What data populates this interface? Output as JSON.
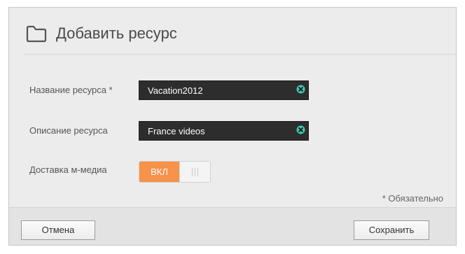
{
  "dialog": {
    "title": "Добавить ресурс",
    "title_icon": "folder-icon"
  },
  "form": {
    "share_name": {
      "label": "Название ресурса *",
      "value": "Vacation2012",
      "clear_icon": "clear-icon"
    },
    "share_description": {
      "label": "Описание ресурса",
      "value": "France videos",
      "clear_icon": "clear-icon"
    },
    "media_serving": {
      "label": "Доставка м-медиа",
      "toggle_label": "ВКЛ",
      "state": "on"
    },
    "required_note": "* Обязательно"
  },
  "footer": {
    "cancel_label": "Отмена",
    "save_label": "Сохранить"
  },
  "colors": {
    "accent_orange": "#f7924a",
    "field_background": "#2d2d2d",
    "clear_icon": "#3fc7b0",
    "dialog_background": "#ececec"
  }
}
